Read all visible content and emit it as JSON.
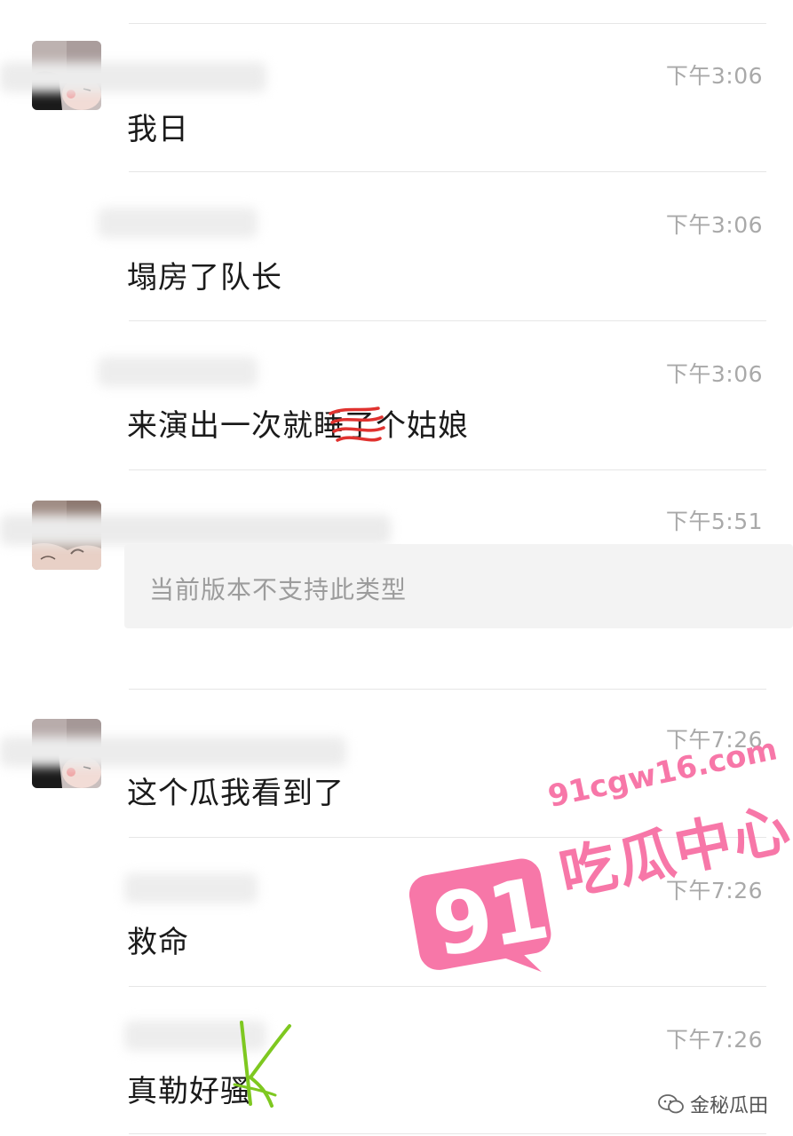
{
  "messages": [
    {
      "time": "下午3:06",
      "text": "我日",
      "avatar": "female-avatar-1"
    },
    {
      "time": "下午3:06",
      "text": "塌房了队长"
    },
    {
      "time": "下午3:06",
      "text": "来演出一次就睡了个姑娘"
    },
    {
      "time": "下午5:51",
      "text": "当前版本不支持此类型",
      "avatar": "female-avatar-2"
    },
    {
      "time": "下午7:26",
      "text": "这个瓜我看到了",
      "avatar": "female-avatar-1"
    },
    {
      "time": "下午7:26",
      "text": "救命"
    },
    {
      "time": "下午7:26",
      "text": "真勒好骚"
    }
  ],
  "watermark": {
    "number": "91",
    "domain": "91cgw16.com",
    "brand": "吃瓜中心",
    "color": "#f777a8"
  },
  "credit": {
    "icon": "wechat-icon",
    "text": "金秘瓜田"
  },
  "colors": {
    "time": "#a9a9a9",
    "text": "#1a1a1a",
    "unsupported_bg": "#f3f3f3",
    "scribble_red": "#e0322f",
    "scribble_green": "#7ec820"
  }
}
